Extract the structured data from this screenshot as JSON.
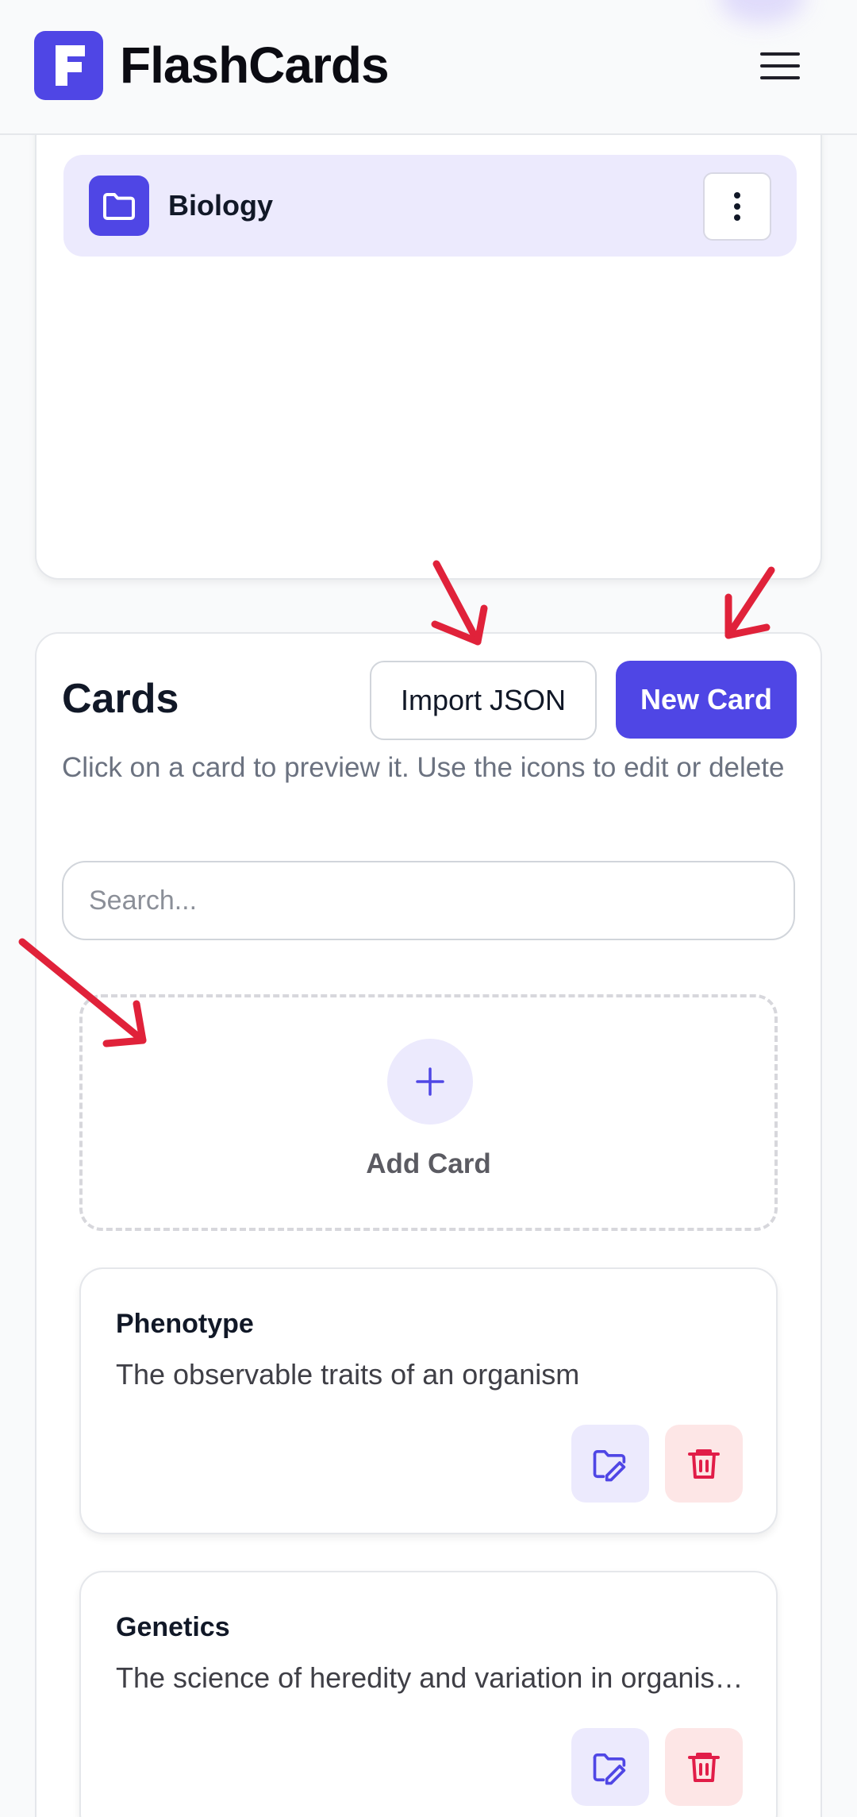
{
  "header": {
    "logo_letter": "F",
    "app_title": "FlashCards",
    "menu_icon": "hamburger-menu-icon"
  },
  "decks": {
    "items": [
      {
        "name": "Biology",
        "icon": "folder-icon"
      }
    ],
    "more_icon": "vertical-dots-icon"
  },
  "cards": {
    "heading": "Cards",
    "import_label": "Import JSON",
    "new_label": "New Card",
    "hint": "Click on a card to preview it. Use the icons to edit or delete",
    "search_placeholder": "Search...",
    "add_label": "Add Card",
    "items": [
      {
        "term": "Phenotype",
        "definition": "The observable traits of an organism"
      },
      {
        "term": "Genetics",
        "definition": "The science of heredity and variation in organisms"
      }
    ]
  },
  "colors": {
    "accent": "#4f46e5",
    "accent_soft": "#eceafd",
    "danger": "#e11d48",
    "danger_soft": "#fde6e6",
    "annotation_arrow": "#e0223a"
  }
}
